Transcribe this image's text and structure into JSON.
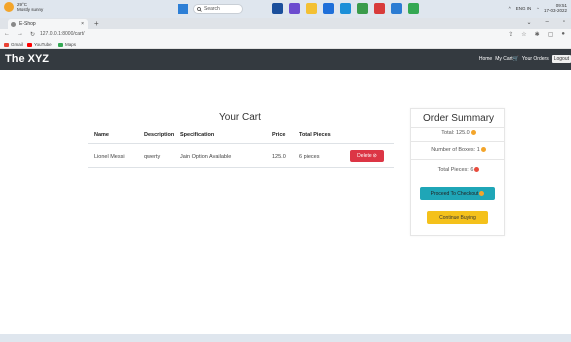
{
  "taskbar": {
    "weather_temp": "29°C",
    "weather_desc": "Mostly sunny",
    "search_label": "Search",
    "tray_lang": "ENG IN",
    "time": "09:51",
    "date": "17-03-2022"
  },
  "browser": {
    "tab_title": "E-Shop",
    "tab_close": "×",
    "new_tab": "+",
    "url": "127.0.0.1:8000/cart/",
    "bookmarks": [
      {
        "label": "Gmail",
        "color": "#ea4335"
      },
      {
        "label": "YouTube",
        "color": "#ff0000"
      },
      {
        "label": "Maps",
        "color": "#34a853"
      }
    ]
  },
  "navbar": {
    "brand": "The XYZ",
    "links": {
      "home": "Home",
      "my_cart": "My Cart🛒",
      "your_orders": "Your Orders",
      "logout": "Logout"
    }
  },
  "cart": {
    "title": "Your Cart",
    "columns": {
      "name": "Name",
      "description": "Description",
      "specification": "Specification",
      "price": "Price",
      "total_pieces": "Total Pieces"
    },
    "rows": [
      {
        "name": "Lionel Messi",
        "description": "qwerty",
        "specification": "Jain Option Available",
        "price": "125.0",
        "pieces": "6 pieces",
        "delete_label": "Delete"
      }
    ]
  },
  "summary": {
    "title": "Order Summary",
    "total": "Total: 125.0",
    "boxes": "Number of Boxes: 1",
    "pieces": "Total Pieces: 6",
    "checkout_label": "Proceed To Checkout",
    "continue_label": "Continue Buying"
  },
  "colors": {
    "navbar": "#343a40",
    "delete": "#dc3545",
    "checkout": "#1fa6b7",
    "continue": "#f4c11b"
  }
}
